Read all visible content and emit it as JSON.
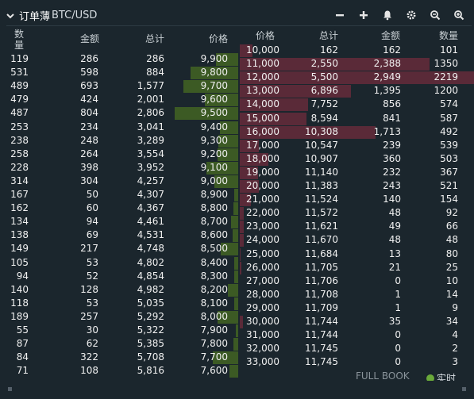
{
  "header": {
    "title_cn": "订单薄",
    "title_pair": "BTC/USD"
  },
  "icons": {
    "collapse": "chevron-down-icon",
    "minus": "minus-icon",
    "plus": "plus-icon",
    "bell": "bell-icon",
    "gear": "gear-icon",
    "zoom_out": "zoom-out-icon",
    "zoom_in": "zoom-in-icon"
  },
  "bids": {
    "headers": {
      "qty": "数量",
      "amount": "金额",
      "total": "总计",
      "price": "价格"
    },
    "rows": [
      {
        "qty": "119",
        "amount": "286",
        "total": "286",
        "price": "9,900"
      },
      {
        "qty": "531",
        "amount": "598",
        "total": "884",
        "price": "9,800"
      },
      {
        "qty": "489",
        "amount": "693",
        "total": "1,577",
        "price": "9,700"
      },
      {
        "qty": "479",
        "amount": "424",
        "total": "2,001",
        "price": "9,600"
      },
      {
        "qty": "487",
        "amount": "804",
        "total": "2,806",
        "price": "9,500"
      },
      {
        "qty": "253",
        "amount": "234",
        "total": "3,041",
        "price": "9,400"
      },
      {
        "qty": "238",
        "amount": "248",
        "total": "3,289",
        "price": "9,300"
      },
      {
        "qty": "258",
        "amount": "264",
        "total": "3,554",
        "price": "9,200"
      },
      {
        "qty": "228",
        "amount": "398",
        "total": "3,952",
        "price": "9,100"
      },
      {
        "qty": "314",
        "amount": "304",
        "total": "4,257",
        "price": "9,000"
      },
      {
        "qty": "167",
        "amount": "50",
        "total": "4,307",
        "price": "8,900"
      },
      {
        "qty": "162",
        "amount": "60",
        "total": "4,367",
        "price": "8,800"
      },
      {
        "qty": "134",
        "amount": "94",
        "total": "4,461",
        "price": "8,700"
      },
      {
        "qty": "138",
        "amount": "69",
        "total": "4,531",
        "price": "8,600"
      },
      {
        "qty": "149",
        "amount": "217",
        "total": "4,748",
        "price": "8,500"
      },
      {
        "qty": "105",
        "amount": "53",
        "total": "4,802",
        "price": "8,400"
      },
      {
        "qty": "94",
        "amount": "52",
        "total": "4,854",
        "price": "8,300"
      },
      {
        "qty": "140",
        "amount": "128",
        "total": "4,982",
        "price": "8,200"
      },
      {
        "qty": "118",
        "amount": "53",
        "total": "5,035",
        "price": "8,100"
      },
      {
        "qty": "189",
        "amount": "257",
        "total": "5,292",
        "price": "8,000"
      },
      {
        "qty": "55",
        "amount": "30",
        "total": "5,322",
        "price": "7,900"
      },
      {
        "qty": "87",
        "amount": "62",
        "total": "5,385",
        "price": "7,800"
      },
      {
        "qty": "84",
        "amount": "322",
        "total": "5,708",
        "price": "7,700"
      },
      {
        "qty": "71",
        "amount": "108",
        "total": "5,816",
        "price": "7,600"
      }
    ]
  },
  "asks": {
    "headers": {
      "price": "价格",
      "total": "总计",
      "amount": "金额",
      "qty": "数量"
    },
    "rows": [
      {
        "price": "10,000",
        "total": "162",
        "amount": "162",
        "qty": "101"
      },
      {
        "price": "11,000",
        "total": "2,550",
        "amount": "2,388",
        "qty": "1350"
      },
      {
        "price": "12,000",
        "total": "5,500",
        "amount": "2,949",
        "qty": "2219"
      },
      {
        "price": "13,000",
        "total": "6,896",
        "amount": "1,395",
        "qty": "1200"
      },
      {
        "price": "14,000",
        "total": "7,752",
        "amount": "856",
        "qty": "574"
      },
      {
        "price": "15,000",
        "total": "8,594",
        "amount": "841",
        "qty": "587"
      },
      {
        "price": "16,000",
        "total": "10,308",
        "amount": "1,713",
        "qty": "492"
      },
      {
        "price": "17,000",
        "total": "10,547",
        "amount": "239",
        "qty": "539"
      },
      {
        "price": "18,000",
        "total": "10,907",
        "amount": "360",
        "qty": "503"
      },
      {
        "price": "19,000",
        "total": "11,140",
        "amount": "232",
        "qty": "367"
      },
      {
        "price": "20,000",
        "total": "11,383",
        "amount": "243",
        "qty": "521"
      },
      {
        "price": "21,000",
        "total": "11,524",
        "amount": "140",
        "qty": "154"
      },
      {
        "price": "22,000",
        "total": "11,572",
        "amount": "48",
        "qty": "92"
      },
      {
        "price": "23,000",
        "total": "11,621",
        "amount": "49",
        "qty": "66"
      },
      {
        "price": "24,000",
        "total": "11,670",
        "amount": "48",
        "qty": "48"
      },
      {
        "price": "25,000",
        "total": "11,684",
        "amount": "13",
        "qty": "80"
      },
      {
        "price": "26,000",
        "total": "11,705",
        "amount": "21",
        "qty": "25"
      },
      {
        "price": "27,000",
        "total": "11,706",
        "amount": "0",
        "qty": "10"
      },
      {
        "price": "28,000",
        "total": "11,708",
        "amount": "1",
        "qty": "14"
      },
      {
        "price": "29,000",
        "total": "11,709",
        "amount": "1",
        "qty": "9"
      },
      {
        "price": "30,000",
        "total": "11,744",
        "amount": "35",
        "qty": "34"
      },
      {
        "price": "31,000",
        "total": "11,744",
        "amount": "0",
        "qty": "4"
      },
      {
        "price": "32,000",
        "total": "11,745",
        "amount": "0",
        "qty": "2"
      },
      {
        "price": "33,000",
        "total": "11,745",
        "amount": "0",
        "qty": "3"
      }
    ]
  },
  "depth": {
    "bid_amount_max": 804,
    "ask_amount_max": 2949,
    "bid_total_max": 5816,
    "ask_total_max": 11745
  },
  "footer": {
    "full_book": "FULL BOOK",
    "realtime": "实时"
  },
  "colors": {
    "background": "#1b262d",
    "bid_bar": "#3c5a24",
    "ask_bar": "#5a2a38",
    "live_dot": "#6aaa3a"
  }
}
